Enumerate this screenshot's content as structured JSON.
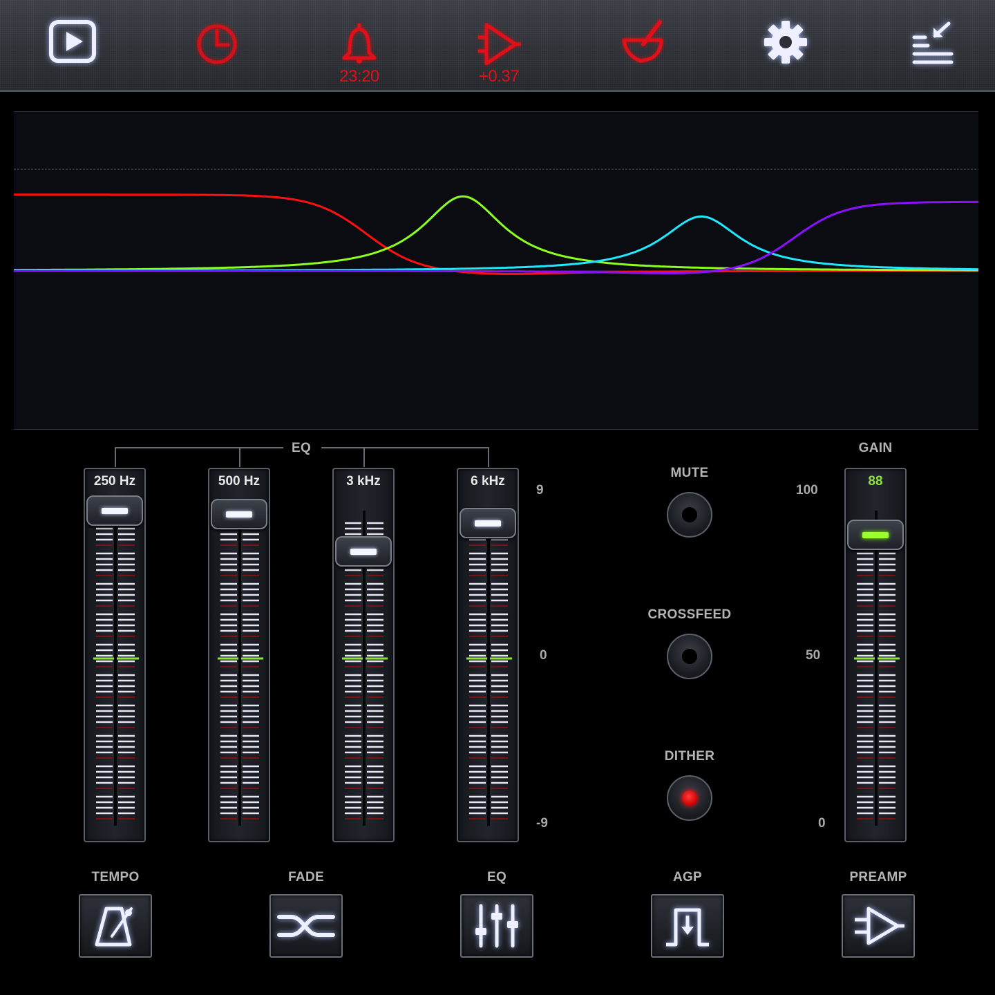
{
  "toolbar": {
    "items": [
      {
        "name": "play-icon",
        "color": "#ffffff"
      },
      {
        "name": "timer-icon",
        "color": "#d4101a"
      },
      {
        "name": "alarm-bell-icon",
        "color": "#e0101a",
        "sub": "23:20"
      },
      {
        "name": "amplifier-icon",
        "color": "#e0101a",
        "sub": "+0.37"
      },
      {
        "name": "mortar-icon",
        "color": "#e0101a"
      },
      {
        "name": "settings-gear-icon",
        "color": "#ffffff"
      },
      {
        "name": "menu-collapse-icon",
        "color": "#ffffff"
      }
    ]
  },
  "eq": {
    "label": "EQ",
    "scale": {
      "max": "9",
      "mid": "0",
      "min": "-9"
    },
    "bands": [
      {
        "label": "250 Hz",
        "value": 8.2,
        "color": "#ff1010"
      },
      {
        "label": "500 Hz",
        "value": 8.0,
        "color": "#8cff20"
      },
      {
        "label": "3 kHz",
        "value": 5.9,
        "color": "#20e8ff"
      },
      {
        "label": "6 kHz",
        "value": 7.5,
        "color": "#8a10ff"
      }
    ]
  },
  "toggles": {
    "mute": {
      "label": "MUTE",
      "on": false
    },
    "crossfeed": {
      "label": "CROSSFEED",
      "on": false
    },
    "dither": {
      "label": "DITHER",
      "on": true
    }
  },
  "gain": {
    "label": "GAIN",
    "value": "88",
    "scale": {
      "max": "100",
      "mid": "50",
      "min": "0"
    }
  },
  "bottom": {
    "tempo": "TEMPO",
    "fade": "FADE",
    "eq": "EQ",
    "agp": "AGP",
    "preamp": "PREAMP"
  }
}
